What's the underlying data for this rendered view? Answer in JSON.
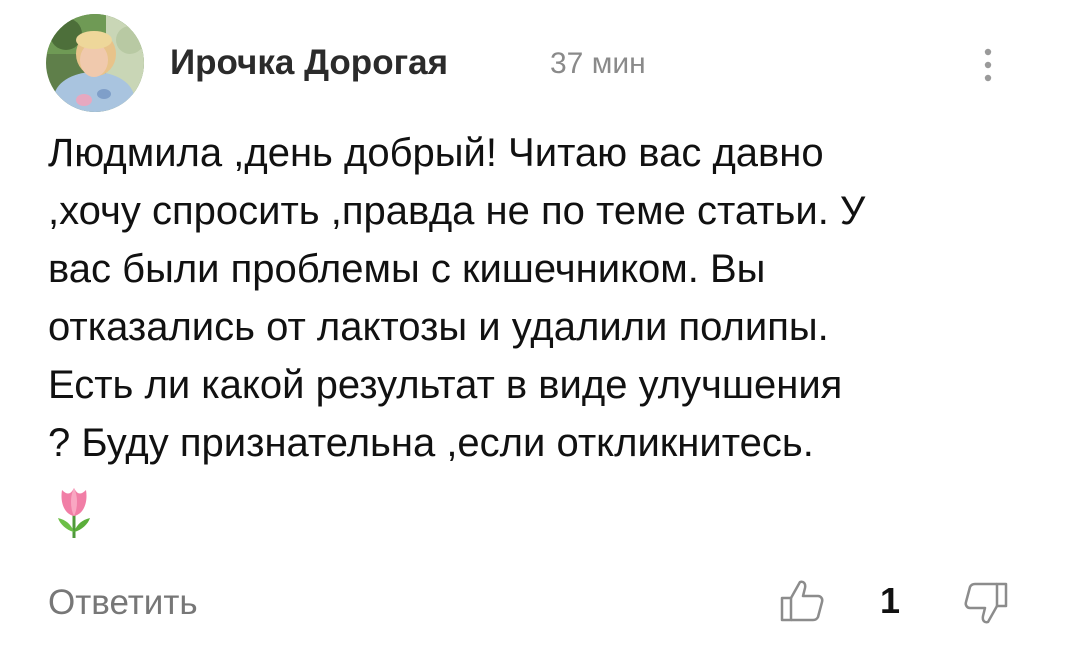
{
  "comment": {
    "author": "Ирочка Дорогая",
    "time": "37 мин",
    "text": "Людмила ,день добрый! Читаю вас давно\n,хочу спросить ,правда не по теме статьи. У\nвас были проблемы с кишечником. Вы\nотказались от лактозы и удалили полипы.\nЕсть ли какой результат в виде улучшения\n? Буду признательна ,если откликнитесь.",
    "emoji": "tulip-icon"
  },
  "actions": {
    "reply_label": "Ответить",
    "like_count": "1",
    "like_icon": "thumbs-up-icon",
    "dislike_icon": "thumbs-down-icon",
    "more_icon": "vertical-ellipsis-icon"
  },
  "colors": {
    "author": "#2b2b2b",
    "time": "#8a8a8a",
    "reply": "#777777",
    "icon": "#8c8c8c"
  }
}
